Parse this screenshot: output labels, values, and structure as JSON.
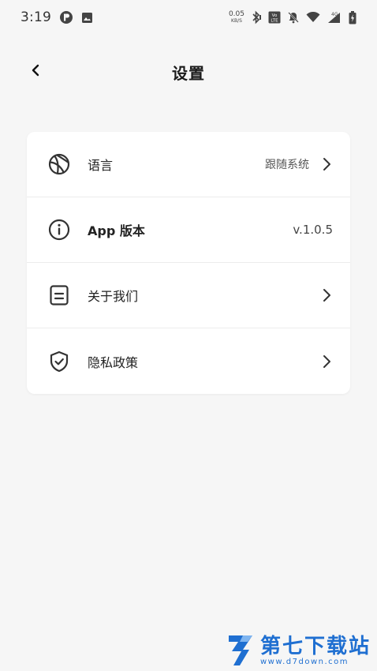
{
  "status_bar": {
    "time": "3:19",
    "net_speed": "0.05",
    "net_unit": "KB/S",
    "network_type": "4G"
  },
  "header": {
    "title": "设置"
  },
  "settings": {
    "items": [
      {
        "label": "语言",
        "value": "跟随系统",
        "icon": "globe-icon",
        "has_chevron": true
      },
      {
        "label": "App 版本",
        "value": "v.1.0.5",
        "icon": "info-icon",
        "has_chevron": false
      },
      {
        "label": "关于我们",
        "value": "",
        "icon": "document-icon",
        "has_chevron": true
      },
      {
        "label": "隐私政策",
        "value": "",
        "icon": "shield-check-icon",
        "has_chevron": true
      }
    ]
  },
  "watermark": {
    "title": "第七下载站",
    "url": "www.d7down.com",
    "accent": "#1f6fd1"
  }
}
